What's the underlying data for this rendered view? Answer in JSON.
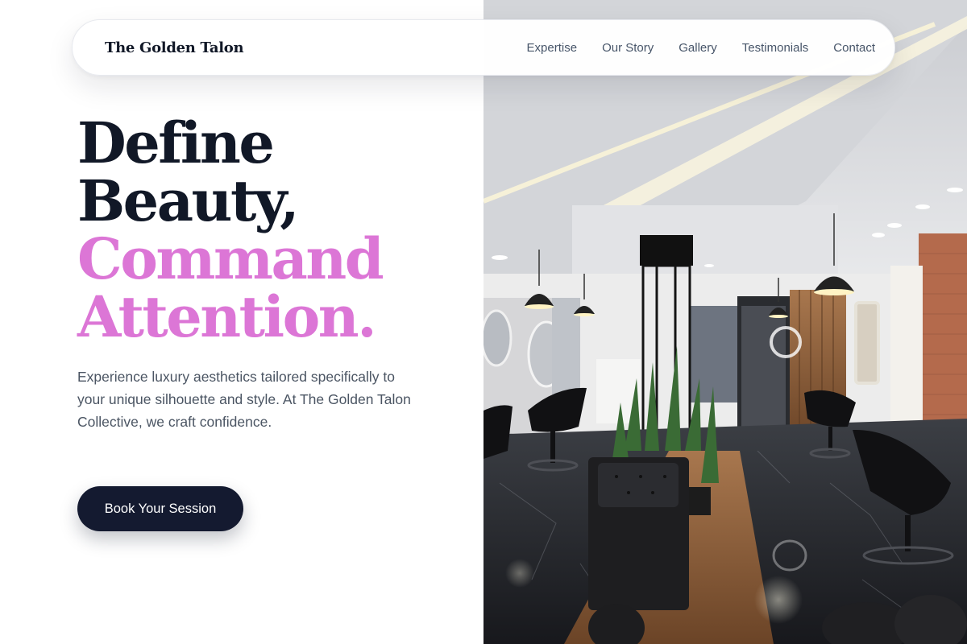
{
  "brand": {
    "name": "The Golden Talon"
  },
  "nav": {
    "links": [
      "Expertise",
      "Our Story",
      "Gallery",
      "Testimonials",
      "Contact"
    ]
  },
  "hero": {
    "headline_line1": "Define",
    "headline_line2": "Beauty,",
    "headline_line3": "Command",
    "headline_line4": "Attention.",
    "description": "Experience luxury aesthetics tailored specifically to your unique silhouette and style. At The Golden Talon Collective, we craft confidence.",
    "cta_label": "Book Your Session"
  },
  "colors": {
    "headline_dark": "#111827",
    "headline_accent": "#dc76d6",
    "button_bg": "#141a30",
    "body_text": "#4b5563"
  }
}
